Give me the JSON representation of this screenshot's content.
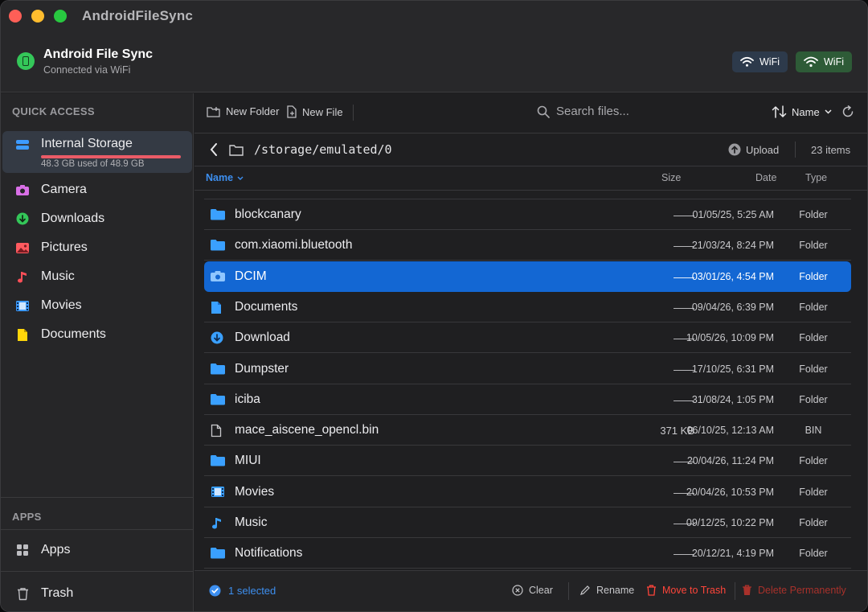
{
  "app": {
    "title": "AndroidFileSync"
  },
  "device": {
    "name": "Android File Sync",
    "status": "Connected via WiFi"
  },
  "header": {
    "wifi_buttons": [
      "WiFi",
      "WiFi"
    ]
  },
  "sidebar": {
    "quick_access_label": "QUICK ACCESS",
    "storage": {
      "label": "Internal Storage",
      "usage": "48.3 GB used of 48.9 GB",
      "used_fraction": 0.988
    },
    "items": [
      {
        "label": "Camera",
        "icon": "camera-icon",
        "color": "#d86fe6"
      },
      {
        "label": "Downloads",
        "icon": "download-icon",
        "color": "#34c759"
      },
      {
        "label": "Pictures",
        "icon": "photo-icon",
        "color": "#ff5a5f"
      },
      {
        "label": "Music",
        "icon": "music-note-icon",
        "color": "#ff4f58"
      },
      {
        "label": "Movies",
        "icon": "film-icon",
        "color": "#3d9bff"
      },
      {
        "label": "Documents",
        "icon": "document-icon",
        "color": "#ffd60a"
      }
    ],
    "apps_label": "APPS",
    "apps_item": "Apps",
    "trash_item": "Trash"
  },
  "toolbar": {
    "new_folder": "New Folder",
    "new_file": "New File",
    "search_placeholder": "Search files...",
    "sort_label": "Name"
  },
  "path": {
    "current": "/storage/emulated/0",
    "upload_label": "Upload",
    "item_count": "23 items"
  },
  "columns": {
    "name": "Name",
    "size": "Size",
    "date": "Date",
    "type": "Type"
  },
  "files": [
    {
      "name": "blockcanary",
      "size": "——",
      "date": "01/05/25, 5:25 AM",
      "type": "Folder",
      "icon": "folder-icon",
      "selected": false
    },
    {
      "name": "com.xiaomi.bluetooth",
      "size": "——",
      "date": "21/03/24, 8:24 PM",
      "type": "Folder",
      "icon": "folder-icon",
      "selected": false
    },
    {
      "name": "DCIM",
      "size": "——",
      "date": "03/01/26, 4:54 PM",
      "type": "Folder",
      "icon": "camera-icon",
      "selected": true
    },
    {
      "name": "Documents",
      "size": "——",
      "date": "09/04/26, 6:39 PM",
      "type": "Folder",
      "icon": "document-icon",
      "selected": false
    },
    {
      "name": "Download",
      "size": "——",
      "date": "10/05/26, 10:09 PM",
      "type": "Folder",
      "icon": "download-icon",
      "selected": false
    },
    {
      "name": "Dumpster",
      "size": "——",
      "date": "17/10/25, 6:31 PM",
      "type": "Folder",
      "icon": "folder-icon",
      "selected": false
    },
    {
      "name": "iciba",
      "size": "——",
      "date": "31/08/24, 1:05 PM",
      "type": "Folder",
      "icon": "folder-icon",
      "selected": false
    },
    {
      "name": "mace_aiscene_opencl.bin",
      "size": "371  KB",
      "date": "06/10/25, 12:13 AM",
      "type": "BIN",
      "icon": "file-icon",
      "selected": false
    },
    {
      "name": "MIUI",
      "size": "——",
      "date": "20/04/26, 11:24 PM",
      "type": "Folder",
      "icon": "folder-icon",
      "selected": false
    },
    {
      "name": "Movies",
      "size": "——",
      "date": "20/04/26, 10:53 PM",
      "type": "Folder",
      "icon": "film-icon",
      "selected": false
    },
    {
      "name": "Music",
      "size": "——",
      "date": "09/12/25, 10:22 PM",
      "type": "Folder",
      "icon": "music-note-icon",
      "selected": false
    },
    {
      "name": "Notifications",
      "size": "——",
      "date": "20/12/21, 4:19 PM",
      "type": "Folder",
      "icon": "folder-icon",
      "selected": false
    }
  ],
  "status": {
    "selected": "1 selected",
    "clear": "Clear",
    "rename": "Rename",
    "move_to_trash": "Move to Trash",
    "delete_permanently": "Delete Permanently"
  },
  "colors": {
    "accent": "#1367d3",
    "link": "#3d8ff0",
    "danger": "#ff453a",
    "danger_dim": "#a8312b",
    "folder": "#3aa0ff"
  }
}
